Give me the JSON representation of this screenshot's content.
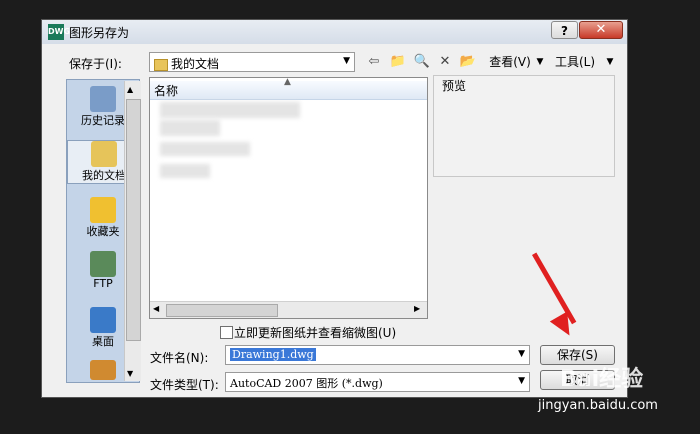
{
  "dialog": {
    "title": "图形另存为",
    "app_icon_text": "DWG",
    "help_label": "?",
    "close_label": "✕"
  },
  "save_in": {
    "label": "保存于(I):",
    "value": "我的文档"
  },
  "toolbar": {
    "view_label": "查看(V)",
    "tools_label": "工具(L)"
  },
  "sidebar": {
    "items": [
      {
        "label": "历史记录",
        "icon": "history-icon",
        "color": "#7a9cc8"
      },
      {
        "label": "我的文档",
        "icon": "documents-icon",
        "color": "#e6c45a"
      },
      {
        "label": "收藏夹",
        "icon": "favorites-icon",
        "color": "#f0c030"
      },
      {
        "label": "FTP",
        "icon": "ftp-icon",
        "color": "#5a8a5a"
      },
      {
        "label": "桌面",
        "icon": "desktop-icon",
        "color": "#3a7ac8"
      }
    ]
  },
  "file_list": {
    "column_name": "名称"
  },
  "preview": {
    "label": "预览"
  },
  "update_thumbnail": {
    "label": "立即更新图纸并查看缩微图(U)",
    "checked": false
  },
  "filename": {
    "label": "文件名(N):",
    "value": "Drawing1.dwg"
  },
  "filetype": {
    "label": "文件类型(T):",
    "value": "AutoCAD 2007 图形 (*.dwg)"
  },
  "buttons": {
    "save": "保存(S)",
    "cancel": "取消"
  },
  "watermark": {
    "brand": "Bai经验",
    "url": "jingyan.baidu.com"
  }
}
